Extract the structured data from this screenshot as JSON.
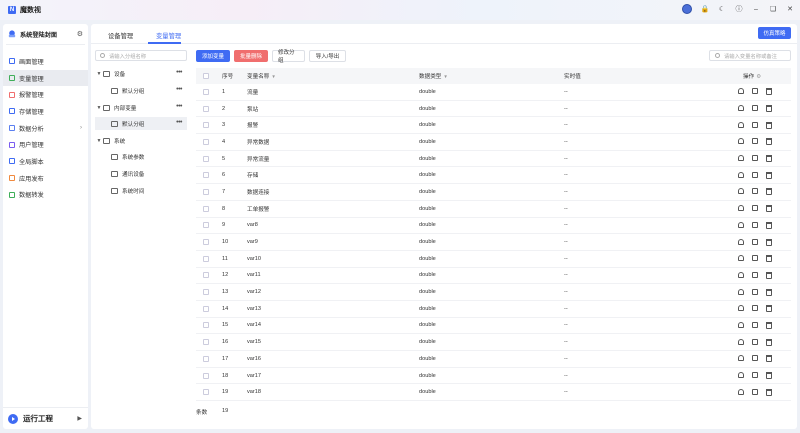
{
  "app": {
    "title": "魔数视",
    "logo_letter": "N"
  },
  "sidebar": {
    "project_title": "系统登陆封面",
    "items": [
      {
        "label": "画面管理",
        "color": "#3f6bf3"
      },
      {
        "label": "变量管理",
        "color": "#3fae59",
        "active": true
      },
      {
        "label": "报警管理",
        "color": "#f06e6e"
      },
      {
        "label": "存储管理",
        "color": "#3f6bf3"
      },
      {
        "label": "数据分析",
        "color": "#5b7ff0",
        "has_arrow": true
      },
      {
        "label": "用户管理",
        "color": "#7a5cf0"
      },
      {
        "label": "全局脚本",
        "color": "#3f6bf3"
      },
      {
        "label": "应用发布",
        "color": "#f08a3f"
      },
      {
        "label": "数据转发",
        "color": "#3fae59"
      }
    ],
    "run_label": "运行工程"
  },
  "tabs": [
    {
      "label": "设备管理"
    },
    {
      "label": "变量管理",
      "active": true
    }
  ],
  "policy_button": "仿真策略",
  "tree": {
    "search_placeholder": "请输入分组名称",
    "nodes": [
      {
        "label": "设备",
        "level": 0,
        "expanded": true
      },
      {
        "label": "默认分组",
        "level": 1
      },
      {
        "label": "内部变量",
        "level": 0,
        "expanded": true
      },
      {
        "label": "默认分组",
        "level": 1,
        "selected": true
      },
      {
        "label": "系统",
        "level": 0,
        "expanded": true
      },
      {
        "label": "系统参数",
        "level": 1
      },
      {
        "label": "通讯设备",
        "level": 1
      },
      {
        "label": "系统时间",
        "level": 1
      }
    ]
  },
  "toolbar": {
    "add": "添加变量",
    "batch_delete": "批量删除",
    "edit_group": "修改分组",
    "import_export": "导入/导出"
  },
  "var_search_placeholder": "请输入变量名称或备注",
  "table": {
    "headers": {
      "no": "序号",
      "name": "变量名称",
      "type": "数据类型",
      "value": "实时值",
      "ops": "操作"
    },
    "rows": [
      {
        "no": "1",
        "name": "流量",
        "type": "double",
        "value": "--"
      },
      {
        "no": "2",
        "name": "泵站",
        "type": "double",
        "value": "--"
      },
      {
        "no": "3",
        "name": "报警",
        "type": "double",
        "value": "--"
      },
      {
        "no": "4",
        "name": "异常数据",
        "type": "double",
        "value": "--"
      },
      {
        "no": "5",
        "name": "异常流量",
        "type": "double",
        "value": "--"
      },
      {
        "no": "6",
        "name": "存储",
        "type": "double",
        "value": "--"
      },
      {
        "no": "7",
        "name": "数据连接",
        "type": "double",
        "value": "--"
      },
      {
        "no": "8",
        "name": "工单报警",
        "type": "double",
        "value": "--"
      },
      {
        "no": "9",
        "name": "var8",
        "type": "double",
        "value": "--"
      },
      {
        "no": "10",
        "name": "var9",
        "type": "double",
        "value": "--"
      },
      {
        "no": "11",
        "name": "var10",
        "type": "double",
        "value": "--"
      },
      {
        "no": "12",
        "name": "var11",
        "type": "double",
        "value": "--"
      },
      {
        "no": "13",
        "name": "var12",
        "type": "double",
        "value": "--"
      },
      {
        "no": "14",
        "name": "var13",
        "type": "double",
        "value": "--"
      },
      {
        "no": "15",
        "name": "var14",
        "type": "double",
        "value": "--"
      },
      {
        "no": "16",
        "name": "var15",
        "type": "double",
        "value": "--"
      },
      {
        "no": "17",
        "name": "var16",
        "type": "double",
        "value": "--"
      },
      {
        "no": "18",
        "name": "var17",
        "type": "double",
        "value": "--"
      },
      {
        "no": "19",
        "name": "var18",
        "type": "double",
        "value": "--"
      }
    ]
  },
  "footer": {
    "label": "条数",
    "count": "19"
  }
}
